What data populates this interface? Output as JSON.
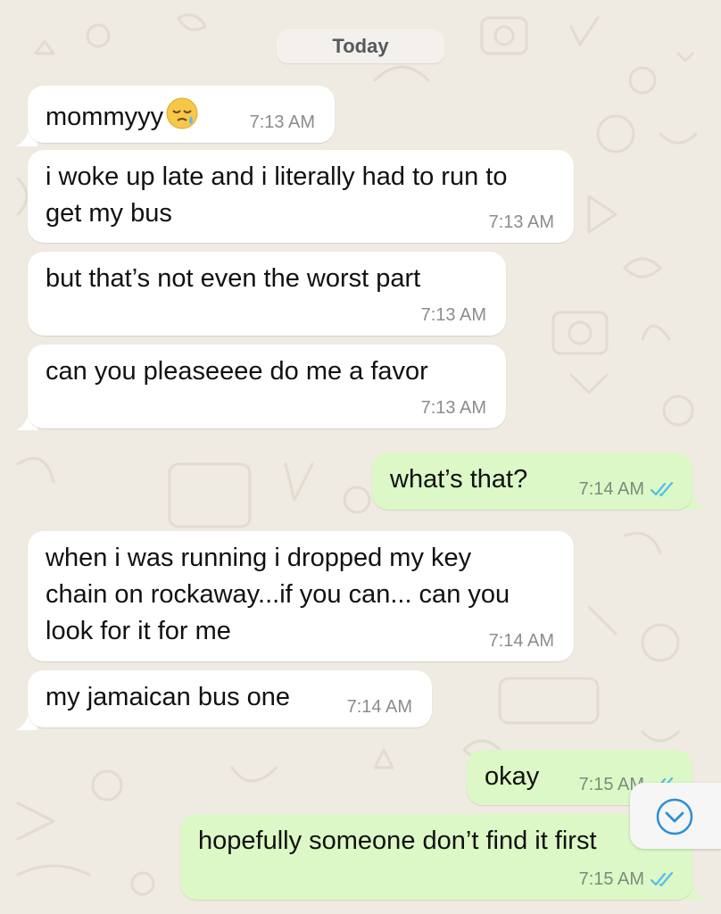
{
  "date_divider": "Today",
  "messages": [
    {
      "side": "in",
      "lines": [
        "mommyyy"
      ],
      "emoji": "sleepy-face",
      "time": "7:13 AM"
    },
    {
      "side": "in",
      "lines": [
        "i woke up late and i literally had to run to",
        "get my bus"
      ],
      "time": "7:13 AM"
    },
    {
      "side": "in",
      "lines": [
        "but that’s not even the worst part"
      ],
      "time": "7:13 AM"
    },
    {
      "side": "in",
      "lines": [
        "can you pleaseeee do me a favor"
      ],
      "time": "7:13 AM"
    },
    {
      "side": "out",
      "lines": [
        "what’s that?"
      ],
      "time": "7:14 AM",
      "status": "read"
    },
    {
      "side": "in",
      "lines": [
        "when i was running i dropped my key",
        "chain on rockaway...if you can... can you",
        "look for it for me"
      ],
      "time": "7:14 AM"
    },
    {
      "side": "in",
      "lines": [
        "my jamaican bus one"
      ],
      "time": "7:14 AM"
    },
    {
      "side": "out",
      "lines": [
        "okay"
      ],
      "time": "7:15 AM",
      "status": "read"
    },
    {
      "side": "out",
      "lines": [
        "hopefully someone don’t find it first"
      ],
      "time": "7:15 AM",
      "status": "read"
    }
  ],
  "colors": {
    "background": "#efeae2",
    "incoming_bubble": "#ffffff",
    "outgoing_bubble": "#dcf8c6",
    "read_ticks": "#53bdeb",
    "scroll_button_accent": "#2f8fd6"
  },
  "icons": {
    "read_receipt": "double-check-icon",
    "scroll_down": "chevron-down-circle-icon",
    "emoji": "sleepy-face-emoji"
  }
}
